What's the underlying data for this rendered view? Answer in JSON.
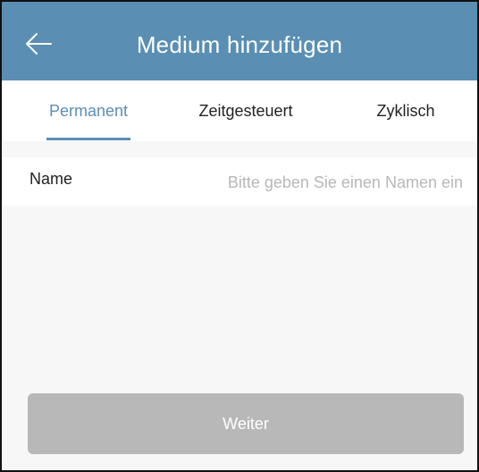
{
  "header": {
    "back_icon": "arrow-left-icon",
    "title": "Medium hinzufügen",
    "color": "#5a8fb3"
  },
  "tabs": [
    {
      "label": "Permanent",
      "active": true
    },
    {
      "label": "Zeitgesteuert",
      "active": false
    },
    {
      "label": "Zyklisch",
      "active": false
    }
  ],
  "form": {
    "name_label": "Name",
    "name_value": "",
    "name_placeholder": "Bitte geben Sie einen Namen ein"
  },
  "actions": {
    "next_label": "Weiter",
    "next_color": "#b8b8b8"
  }
}
